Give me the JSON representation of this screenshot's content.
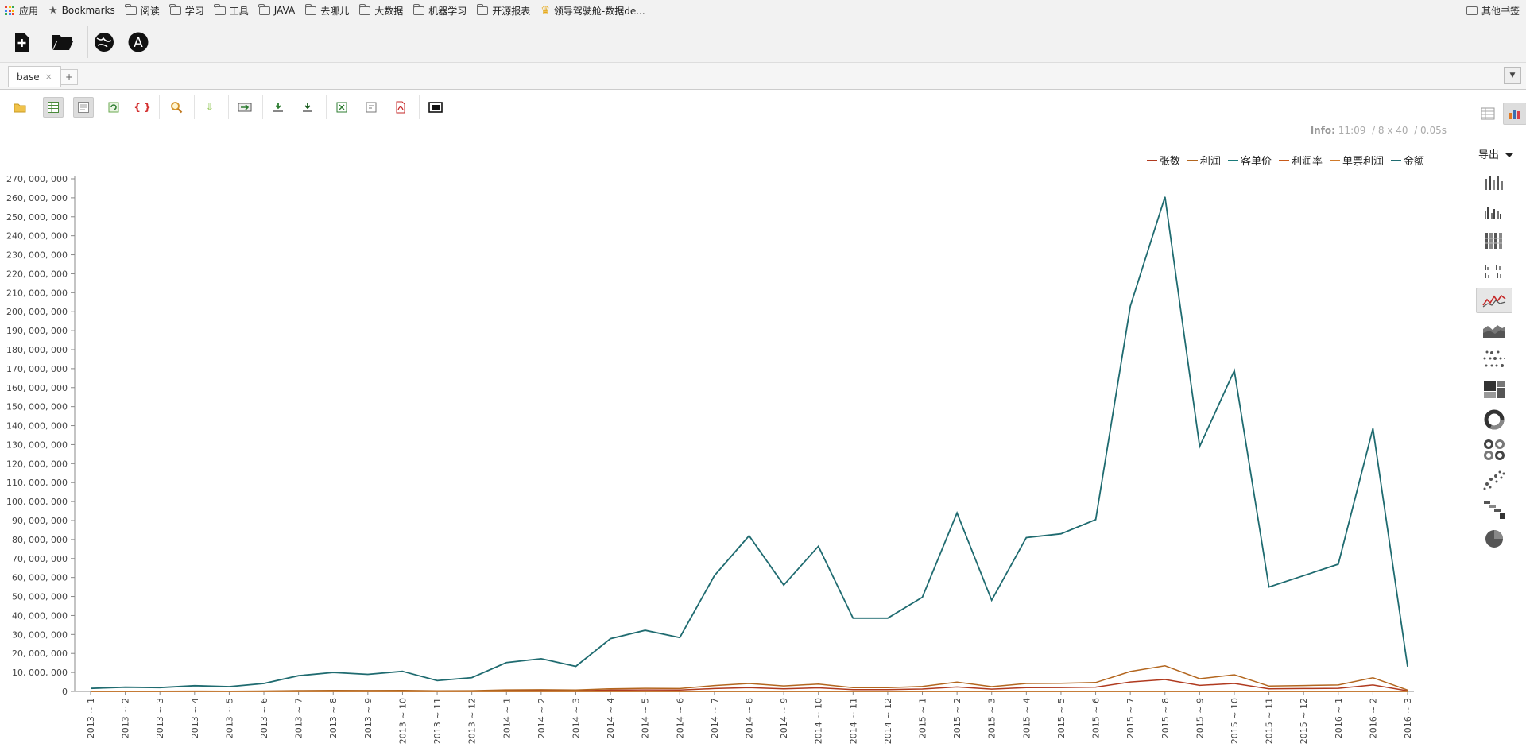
{
  "bookmarks": {
    "apps": "应用",
    "bookmarks": "Bookmarks",
    "folders": [
      "阅读",
      "学习",
      "工具",
      "JAVA",
      "去哪儿",
      "大数据",
      "机器学习",
      "开源报表"
    ],
    "special": "领导驾驶舱-数据de...",
    "right": "其他书签"
  },
  "tabs": {
    "active": "base",
    "close": "×",
    "add": "+",
    "dropdown": "▼"
  },
  "info": {
    "label": "Info:",
    "time": "11:09",
    "size": "/ 8 x 40",
    "duration": "/ 0.05s"
  },
  "rightpanel": {
    "export": "导出"
  },
  "icons": {
    "main": [
      "new-file-icon",
      "open-folder-icon",
      "language-globe-icon",
      "account-a-icon"
    ],
    "grid": [
      "open-icon",
      "table-view-icon",
      "form-view-icon",
      "refresh-icon",
      "variable-icon",
      "search-icon",
      "download-arrow-icon",
      "export-arrow-icon",
      "save-icon",
      "save-as-icon",
      "excel-icon",
      "word-icon",
      "pdf-icon",
      "screen-icon"
    ],
    "charts": [
      "bar-chart-icon",
      "grouped-bar-icon",
      "stacked-bar-icon",
      "multi-bar-icon",
      "line-chart-icon",
      "area-chart-icon",
      "scatter-chart-icon",
      "treemap-icon",
      "donut-chart-icon",
      "multi-donut-icon",
      "bubble-icon",
      "waterfall-icon",
      "pie-chart-icon"
    ]
  },
  "colors": {
    "teal": "#1f6b70",
    "orange": "#b3661f",
    "red": "#b03a1f",
    "darkred": "#8a2a12"
  },
  "chart_data": {
    "type": "line",
    "ylim": [
      0,
      270000000
    ],
    "yticks": [
      "0",
      "10, 000, 000",
      "20, 000, 000",
      "30, 000, 000",
      "40, 000, 000",
      "50, 000, 000",
      "60, 000, 000",
      "70, 000, 000",
      "80, 000, 000",
      "90, 000, 000",
      "100, 000, 000",
      "110, 000, 000",
      "120, 000, 000",
      "130, 000, 000",
      "140, 000, 000",
      "150, 000, 000",
      "160, 000, 000",
      "170, 000, 000",
      "180, 000, 000",
      "190, 000, 000",
      "200, 000, 000",
      "210, 000, 000",
      "220, 000, 000",
      "230, 000, 000",
      "240, 000, 000",
      "250, 000, 000",
      "260, 000, 000",
      "270, 000, 000"
    ],
    "categories": [
      "2013 ~ 1",
      "2013 ~ 2",
      "2013 ~ 3",
      "2013 ~ 4",
      "2013 ~ 5",
      "2013 ~ 6",
      "2013 ~ 7",
      "2013 ~ 8",
      "2013 ~ 9",
      "2013 ~ 10",
      "2013 ~ 11",
      "2013 ~ 12",
      "2014 ~ 1",
      "2014 ~ 2",
      "2014 ~ 3",
      "2014 ~ 4",
      "2014 ~ 5",
      "2014 ~ 6",
      "2014 ~ 7",
      "2014 ~ 8",
      "2014 ~ 9",
      "2014 ~ 10",
      "2014 ~ 11",
      "2014 ~ 12",
      "2015 ~ 1",
      "2015 ~ 2",
      "2015 ~ 3",
      "2015 ~ 4",
      "2015 ~ 5",
      "2015 ~ 6",
      "2015 ~ 7",
      "2015 ~ 8",
      "2015 ~ 9",
      "2015 ~ 10",
      "2015 ~ 11",
      "2015 ~ 12",
      "2016 ~ 1",
      "2016 ~ 2",
      "2016 ~ 3"
    ],
    "series": [
      {
        "name": "张数",
        "color": "#b03a1f",
        "values": [
          50000,
          60000,
          60000,
          80000,
          70000,
          100000,
          200000,
          250000,
          220000,
          280000,
          150000,
          180000,
          380000,
          420000,
          330000,
          680000,
          800000,
          720000,
          1500000,
          2000000,
          1400000,
          1900000,
          950000,
          960000,
          1250000,
          2350000,
          1200000,
          2000000,
          2050000,
          2250000,
          5000000,
          6300000,
          3200000,
          4200000,
          1350000,
          1500000,
          1650000,
          3400000,
          330000
        ]
      },
      {
        "name": "利润",
        "color": "#b3661f",
        "values": [
          100000,
          120000,
          120000,
          160000,
          140000,
          220000,
          420000,
          500000,
          450000,
          540000,
          300000,
          360000,
          780000,
          880000,
          700000,
          1400000,
          1650000,
          1500000,
          3100000,
          4200000,
          2900000,
          3900000,
          2000000,
          2000000,
          2600000,
          4900000,
          2500000,
          4200000,
          4300000,
          4700000,
          10500000,
          13500000,
          6700000,
          8800000,
          2800000,
          3100000,
          3400000,
          7200000,
          700000
        ]
      },
      {
        "name": "客单价",
        "color": "#1a7a7a",
        "values": [
          600,
          620,
          610,
          650,
          640,
          660,
          690,
          700,
          690,
          710,
          680,
          700,
          720,
          730,
          720,
          750,
          760,
          750,
          780,
          800,
          780,
          790,
          760,
          760,
          770,
          810,
          770,
          800,
          800,
          810,
          860,
          880,
          830,
          850,
          790,
          800,
          800,
          840,
          720
        ]
      },
      {
        "name": "利润率",
        "color": "#c85a1a",
        "values": [
          1,
          1,
          1,
          1,
          1,
          1,
          1,
          1,
          1,
          1,
          1,
          1,
          1,
          1,
          1,
          1,
          1,
          1,
          1,
          1,
          1,
          1,
          1,
          1,
          1,
          1,
          1,
          1,
          1,
          1,
          1,
          1,
          1,
          1,
          1,
          1,
          1,
          1,
          1
        ]
      },
      {
        "name": "单票利润",
        "color": "#d07a2a",
        "values": [
          40,
          40,
          40,
          40,
          40,
          40,
          40,
          40,
          40,
          40,
          40,
          40,
          40,
          40,
          40,
          40,
          40,
          40,
          40,
          40,
          40,
          40,
          40,
          40,
          40,
          40,
          40,
          40,
          40,
          40,
          40,
          40,
          40,
          40,
          40,
          40,
          40,
          40,
          40
        ]
      },
      {
        "name": "金额",
        "color": "#1f6b70",
        "values": [
          1600000,
          2200000,
          2000000,
          3000000,
          2500000,
          4200000,
          8300000,
          10000000,
          9000000,
          10600000,
          5700000,
          7300000,
          15200000,
          17200000,
          13200000,
          27800000,
          32200000,
          28400000,
          61000000,
          82000000,
          56000000,
          76500000,
          38600000,
          38600000,
          49600000,
          94000000,
          48000000,
          81000000,
          83000000,
          90500000,
          203000000,
          260500000,
          129000000,
          169000000,
          55000000,
          61000000,
          67000000,
          138500000,
          13000000
        ]
      }
    ]
  }
}
